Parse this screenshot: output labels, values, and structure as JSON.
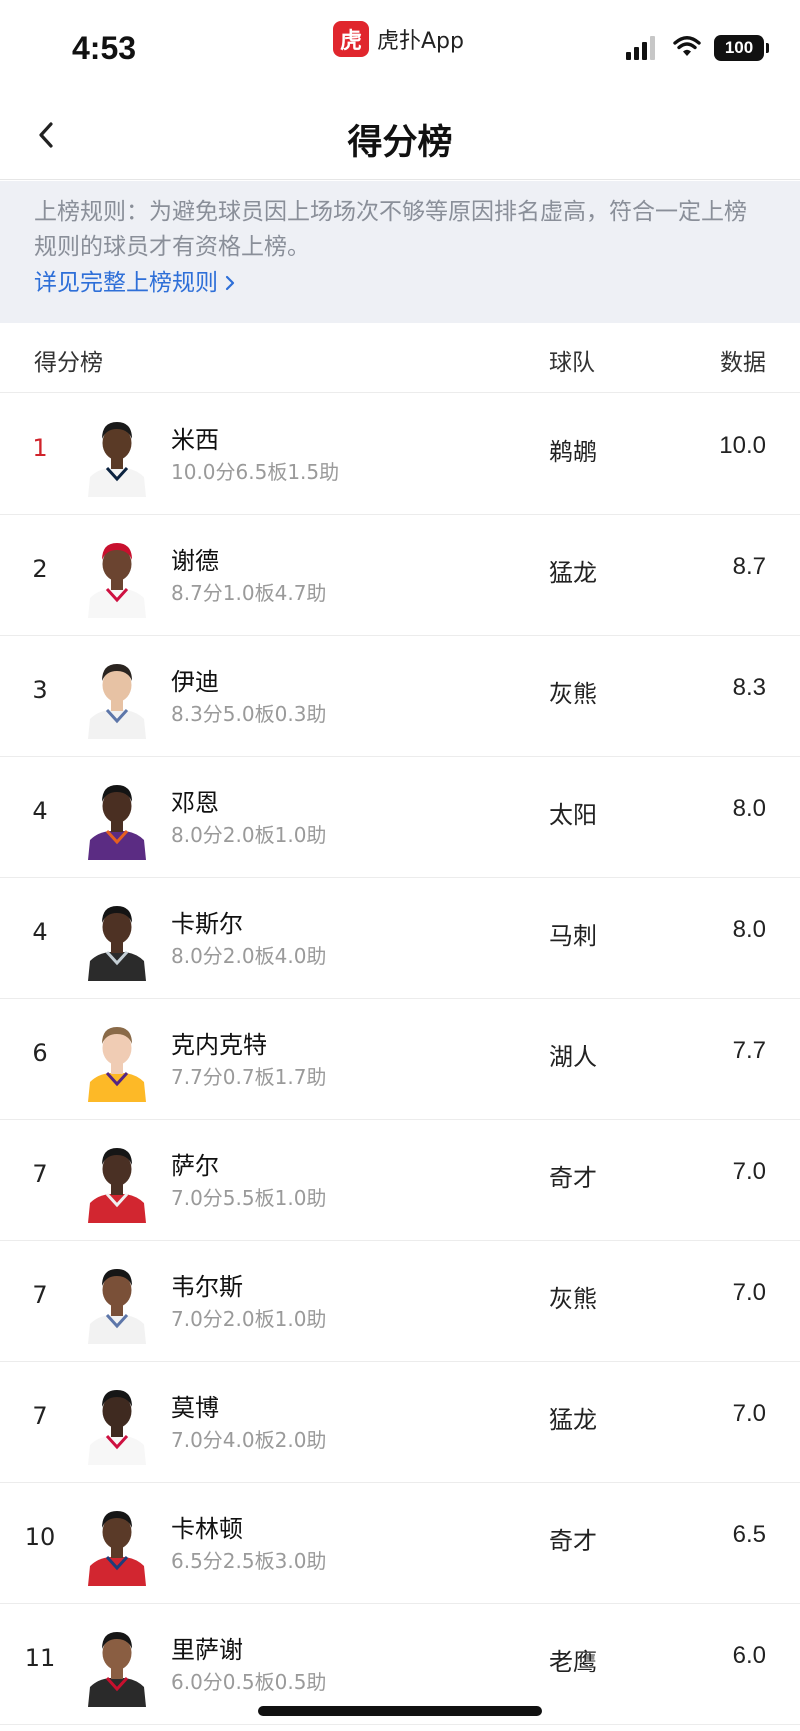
{
  "status_bar": {
    "time": "4:53",
    "app_logo_text": "虎",
    "app_name": "虎扑App",
    "battery": "100",
    "icons": [
      "signal-icon",
      "wifi-icon",
      "battery-icon"
    ]
  },
  "nav": {
    "title": "得分榜",
    "back_icon": "chevron-left-icon"
  },
  "rules": {
    "text": "上榜规则：为避免球员因上场场次不够等原因排名虚高，符合一定上榜规则的球员才有资格上榜。",
    "link": "详见完整上榜规则",
    "link_color": "#2e6fd8"
  },
  "table": {
    "headers": {
      "board": "得分榜",
      "team": "球队",
      "data": "数据"
    },
    "rows": [
      {
        "rank": "1",
        "name": "米西",
        "line": "10.0分6.5板1.5助",
        "team": "鹈鹕",
        "value": "10.0",
        "jersey": "#f4f4f4",
        "trim": "#0c2340",
        "skin": "#5a3a26",
        "hair": "#1a1a1a"
      },
      {
        "rank": "2",
        "name": "谢德",
        "line": "8.7分1.0板4.7助",
        "team": "猛龙",
        "value": "8.7",
        "jersey": "#f7f7f7",
        "trim": "#ce1141",
        "skin": "#6b4430",
        "hair": "#c8102e"
      },
      {
        "rank": "3",
        "name": "伊迪",
        "line": "8.3分5.0板0.3助",
        "team": "灰熊",
        "value": "8.3",
        "jersey": "#f2f2f2",
        "trim": "#5d76a9",
        "skin": "#e7c2a4",
        "hair": "#2a2420"
      },
      {
        "rank": "4",
        "name": "邓恩",
        "line": "8.0分2.0板1.0助",
        "team": "太阳",
        "value": "8.0",
        "jersey": "#5b2c83",
        "trim": "#e56020",
        "skin": "#4a2f22",
        "hair": "#141414"
      },
      {
        "rank": "4",
        "name": "卡斯尔",
        "line": "8.0分2.0板4.0助",
        "team": "马刺",
        "value": "8.0",
        "jersey": "#2b2b2b",
        "trim": "#c4ced4",
        "skin": "#4e3224",
        "hair": "#141414"
      },
      {
        "rank": "6",
        "name": "克内克特",
        "line": "7.7分0.7板1.7助",
        "team": "湖人",
        "value": "7.7",
        "jersey": "#fdb927",
        "trim": "#552583",
        "skin": "#f0ccb4",
        "hair": "#8a6a48"
      },
      {
        "rank": "7",
        "name": "萨尔",
        "line": "7.0分5.5板1.0助",
        "team": "奇才",
        "value": "7.0",
        "jersey": "#d22630",
        "trim": "#f0f0f0",
        "skin": "#4a3024",
        "hair": "#161616"
      },
      {
        "rank": "7",
        "name": "韦尔斯",
        "line": "7.0分2.0板1.0助",
        "team": "灰熊",
        "value": "7.0",
        "jersey": "#f2f2f2",
        "trim": "#5d76a9",
        "skin": "#7a5038",
        "hair": "#161616"
      },
      {
        "rank": "7",
        "name": "莫博",
        "line": "7.0分4.0板2.0助",
        "team": "猛龙",
        "value": "7.0",
        "jersey": "#f7f7f7",
        "trim": "#ce1141",
        "skin": "#3f2a20",
        "hair": "#161616"
      },
      {
        "rank": "10",
        "name": "卡林顿",
        "line": "6.5分2.5板3.0助",
        "team": "奇才",
        "value": "6.5",
        "jersey": "#d22630",
        "trim": "#1d3d7a",
        "skin": "#5a3a28",
        "hair": "#161616"
      },
      {
        "rank": "11",
        "name": "里萨谢",
        "line": "6.0分0.5板0.5助",
        "team": "老鹰",
        "value": "6.0",
        "jersey": "#2a2a2a",
        "trim": "#c8102e",
        "skin": "#8a5e42",
        "hair": "#161616"
      }
    ]
  }
}
